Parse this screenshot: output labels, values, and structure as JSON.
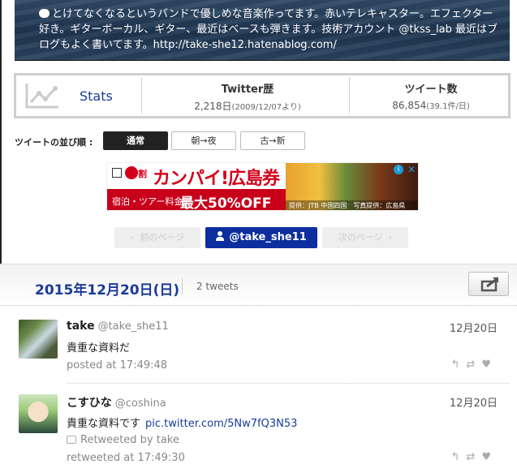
{
  "banner": {
    "text": "とけてなくなるというバンドで優しめな音楽作ってます。赤いテレキャスター。エフェクター好き。ギターボーカル、ギター、最近はベースも弾きます。技術アカウント @tkss_lab 最近はブログもよく書いてます。http://take-she12.hatenablog.com/"
  },
  "stats": {
    "label": "Stats",
    "twitter_history_title": "Twitter歴",
    "twitter_history_value": "2,218日",
    "twitter_history_sub": "(2009/12/07より)",
    "tweets_title": "ツイート数",
    "tweets_value": "86,854",
    "tweets_sub": "(39.1件/日)"
  },
  "sort": {
    "label": "ツイートの並び順 :",
    "options": [
      "通常",
      "朝→夜",
      "古→新"
    ]
  },
  "ad": {
    "logo_text": "割",
    "headline": "カンパイ!広島券",
    "sub_text": "宿泊・ツアー料金",
    "discount": "最大50%OFF",
    "caption": "提供：JTB 中国四国　写真提供：広島県",
    "info": "i",
    "close": "✕"
  },
  "pager": {
    "prev": "前のページ",
    "me": "@take_she11",
    "next": "次のページ"
  },
  "date_header": {
    "date": "2015年12月20日(日)",
    "count": "2 tweets"
  },
  "tweets": [
    {
      "name": "take",
      "handle": "@take_she11",
      "date": "12月20日",
      "body": "貴重な資料だ",
      "meta": "posted at 17:49:48"
    },
    {
      "name": "こすひな",
      "handle": "@coshina",
      "date": "12月20日",
      "body": "貴重な資料です",
      "link": "pic.twitter.com/5Nw7fQ3N53",
      "retweeted_by": "Retweeted by take",
      "meta": "retweeted at 17:49:30"
    }
  ],
  "icons": {
    "reply": "↰",
    "retweet": "⇄",
    "favorite": "♥",
    "chevron_left": "‹",
    "chevron_right": "›"
  }
}
